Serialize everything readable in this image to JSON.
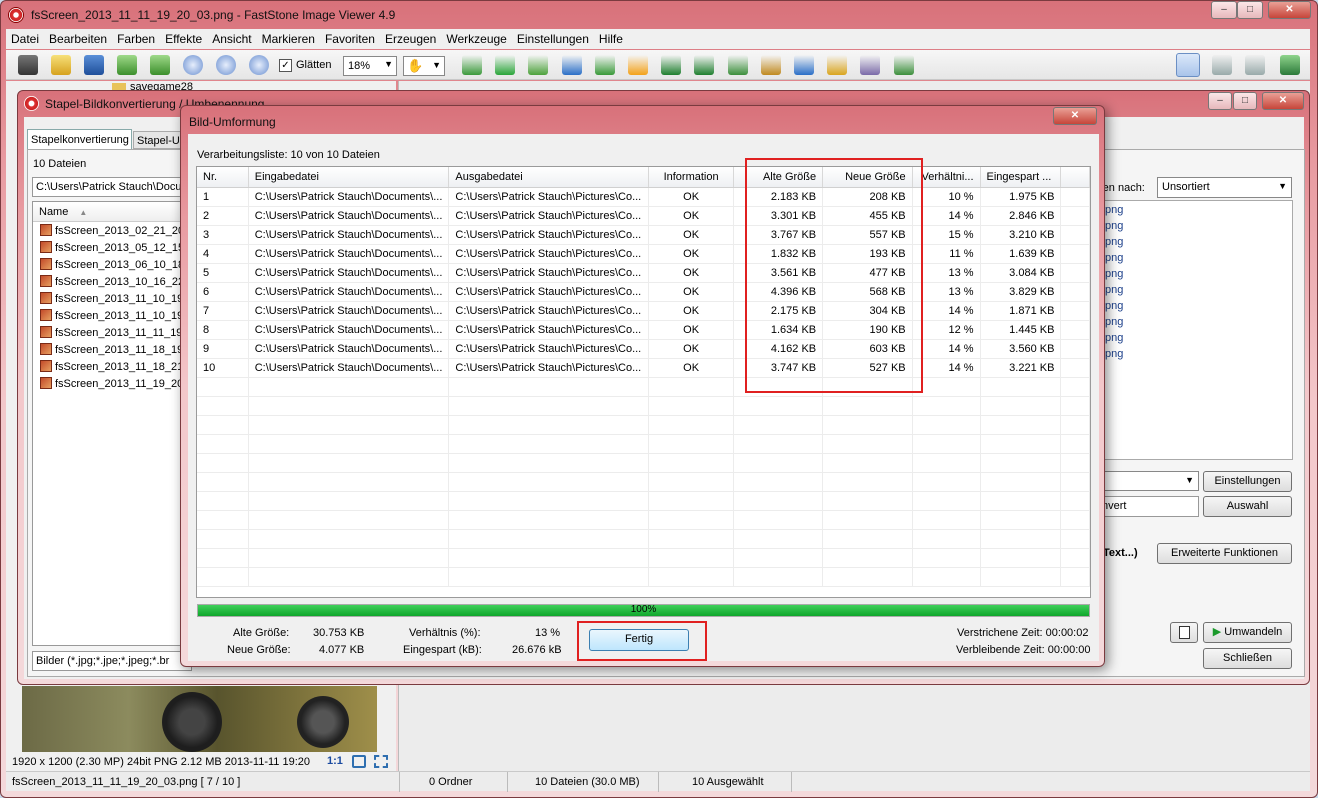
{
  "main_window": {
    "title": "fsScreen_2013_11_11_19_20_03.png  -  FastStone Image Viewer 4.9",
    "caption_buttons": {
      "minimize": "–",
      "maximize": "□",
      "close": "✕"
    }
  },
  "menu": [
    "Datei",
    "Bearbeiten",
    "Farben",
    "Effekte",
    "Ansicht",
    "Markieren",
    "Favoriten",
    "Erzeugen",
    "Werkzeuge",
    "Einstellungen",
    "Hilfe"
  ],
  "toolbar": {
    "smooth_label": "Glätten",
    "zoom_value": "18%",
    "icons": [
      "camera-icon",
      "open-folder-icon",
      "save-icon",
      "back-icon",
      "forward-icon",
      "zoom-in-icon",
      "zoom-out-icon",
      "actual-size-icon"
    ],
    "icons_right": [
      "slideshow-icon",
      "resize-icon",
      "crop-icon",
      "convert-icon",
      "stamp-icon",
      "sun-icon",
      "rotate-left-icon",
      "rotate-right-icon",
      "compare-icon",
      "frame-icon",
      "draw-icon",
      "email-icon",
      "print-icon",
      "settings-icon"
    ],
    "layout_icons": [
      "layout-1-icon",
      "layout-2-icon",
      "layout-3-icon",
      "fullscreen-icon"
    ]
  },
  "behind_text": {
    "folder_item": "savegame28"
  },
  "batch_window": {
    "title": "Stapel-Bildkonvertierung / Umbenennung",
    "tabs": [
      "Stapelkonvertierung",
      "Stapel-U"
    ],
    "file_count": "10 Dateien",
    "path": "C:\\Users\\Patrick Stauch\\Docun",
    "name_header": "Name",
    "files": [
      "fsScreen_2013_02_21_20",
      "fsScreen_2013_05_12_15",
      "fsScreen_2013_06_10_18",
      "fsScreen_2013_10_16_22",
      "fsScreen_2013_11_10_19",
      "fsScreen_2013_11_10_19",
      "fsScreen_2013_11_11_19",
      "fsScreen_2013_11_18_19",
      "fsScreen_2013_11_18_21",
      "fsScreen_2013_11_19_20"
    ],
    "filter": "Bilder (*.jpg;*.jpe;*.jpeg;*.br",
    "sort_label": "ren nach:",
    "sort_value": "Unsortiert",
    "right_list": [
      "png",
      "png",
      "png",
      "png",
      "png",
      "png",
      "png",
      "png",
      "png",
      "png"
    ],
    "settings_button": "Einstellungen",
    "convert_field": "nvert",
    "select_button": "Auswahl",
    "text_label": "Text...)",
    "advanced_button": "Erweiterte Funktionen",
    "convert_button": "Umwandeln",
    "close_button": "Schließen"
  },
  "dialog": {
    "title": "Bild-Umformung",
    "close": "✕",
    "list_label": "Verarbeitungsliste: 10 von 10 Dateien",
    "columns": [
      "Nr.",
      "Eingabedatei",
      "Ausgabedatei",
      "Information",
      "Alte Größe",
      "Neue Größe",
      "Verhältni...",
      "Eingespart ..."
    ],
    "rows": [
      [
        "1",
        "C:\\Users\\Patrick Stauch\\Documents\\...",
        "C:\\Users\\Patrick Stauch\\Pictures\\Co...",
        "OK",
        "2.183 KB",
        "208 KB",
        "10 %",
        "1.975 KB"
      ],
      [
        "2",
        "C:\\Users\\Patrick Stauch\\Documents\\...",
        "C:\\Users\\Patrick Stauch\\Pictures\\Co...",
        "OK",
        "3.301 KB",
        "455 KB",
        "14 %",
        "2.846 KB"
      ],
      [
        "3",
        "C:\\Users\\Patrick Stauch\\Documents\\...",
        "C:\\Users\\Patrick Stauch\\Pictures\\Co...",
        "OK",
        "3.767 KB",
        "557 KB",
        "15 %",
        "3.210 KB"
      ],
      [
        "4",
        "C:\\Users\\Patrick Stauch\\Documents\\...",
        "C:\\Users\\Patrick Stauch\\Pictures\\Co...",
        "OK",
        "1.832 KB",
        "193 KB",
        "11 %",
        "1.639 KB"
      ],
      [
        "5",
        "C:\\Users\\Patrick Stauch\\Documents\\...",
        "C:\\Users\\Patrick Stauch\\Pictures\\Co...",
        "OK",
        "3.561 KB",
        "477 KB",
        "13 %",
        "3.084 KB"
      ],
      [
        "6",
        "C:\\Users\\Patrick Stauch\\Documents\\...",
        "C:\\Users\\Patrick Stauch\\Pictures\\Co...",
        "OK",
        "4.396 KB",
        "568 KB",
        "13 %",
        "3.829 KB"
      ],
      [
        "7",
        "C:\\Users\\Patrick Stauch\\Documents\\...",
        "C:\\Users\\Patrick Stauch\\Pictures\\Co...",
        "OK",
        "2.175 KB",
        "304 KB",
        "14 %",
        "1.871 KB"
      ],
      [
        "8",
        "C:\\Users\\Patrick Stauch\\Documents\\...",
        "C:\\Users\\Patrick Stauch\\Pictures\\Co...",
        "OK",
        "1.634 KB",
        "190 KB",
        "12 %",
        "1.445 KB"
      ],
      [
        "9",
        "C:\\Users\\Patrick Stauch\\Documents\\...",
        "C:\\Users\\Patrick Stauch\\Pictures\\Co...",
        "OK",
        "4.162 KB",
        "603 KB",
        "14 %",
        "3.560 KB"
      ],
      [
        "10",
        "C:\\Users\\Patrick Stauch\\Documents\\...",
        "C:\\Users\\Patrick Stauch\\Pictures\\Co...",
        "OK",
        "3.747 KB",
        "527 KB",
        "14 %",
        "3.221 KB"
      ]
    ],
    "progress_value": 1.0,
    "progress_text": "100%",
    "summary": {
      "old_size_label": "Alte Größe:",
      "old_size": "30.753 KB",
      "new_size_label": "Neue Größe:",
      "new_size": "4.077 KB",
      "ratio_label": "Verhältnis (%):",
      "ratio": "13 %",
      "saved_label": "Eingespart (kB):",
      "saved": "26.676 kB",
      "elapsed": "Verstrichene Zeit: 00:00:02",
      "remaining": "Verbleibende Zeit: 00:00:00"
    },
    "done_button": "Fertig",
    "highlight_color": "#e02020"
  },
  "image_info": {
    "info": "1920 x 1200 (2.30 MP)  24bit  PNG   2.12 MB   2013-11-11 19:20",
    "ratio": "1:1"
  },
  "statusbar": {
    "file": "fsScreen_2013_11_11_19_20_03.png [ 7 / 10 ]",
    "folders": "0 Ordner",
    "files": "10 Dateien (30.0 MB)",
    "selected": "10 Ausgewählt"
  }
}
